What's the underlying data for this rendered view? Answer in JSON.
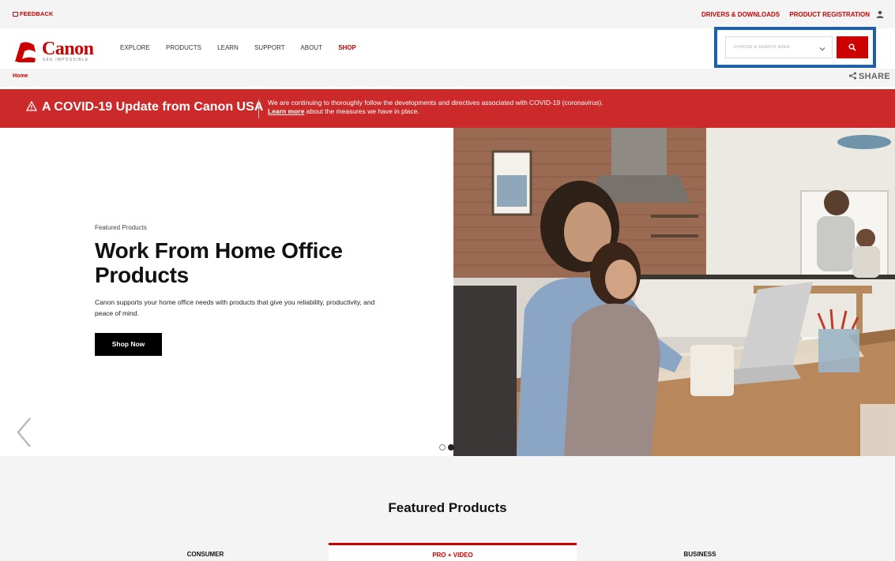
{
  "utility_bar": {
    "feedback": "FEEDBACK",
    "links": [
      "DRIVERS & DOWNLOADS",
      "PRODUCT REGISTRATION"
    ]
  },
  "header": {
    "logo_text": "Canon",
    "logo_tagline": "SEE IMPOSSIBLE",
    "nav": [
      "EXPLORE",
      "PRODUCTS",
      "LEARN",
      "SUPPORT",
      "ABOUT",
      "SHOP"
    ],
    "search": {
      "placeholder": "CHOOSE A SEARCH AREA"
    }
  },
  "breadcrumb": {
    "home": "Home",
    "share": "SHARE"
  },
  "covid_banner": {
    "title": "A COVID-19 Update from Canon USA",
    "line1": "We are continuing to thoroughly follow the developments and directives associated with COVID-19 (coronavirus).",
    "learn_more": "Learn more",
    "line2_rest": " about the measures we have in place."
  },
  "hero": {
    "eyebrow": "Featured Products",
    "title": "Work From Home Office Products",
    "description": "Canon supports your home office needs with products that give you reliability, productivity, and peace of mind.",
    "cta": "Shop Now",
    "slide_active": 2,
    "slide_count": 2
  },
  "featured": {
    "title": "Featured Products",
    "tabs": [
      "CONSUMER",
      "PRO + VIDEO",
      "BUSINESS"
    ],
    "active_tab": "PRO + VIDEO"
  },
  "colors": {
    "brand_red": "#cc0000",
    "banner_red": "#cc2a2a",
    "search_outline": "#1f5fa6"
  }
}
